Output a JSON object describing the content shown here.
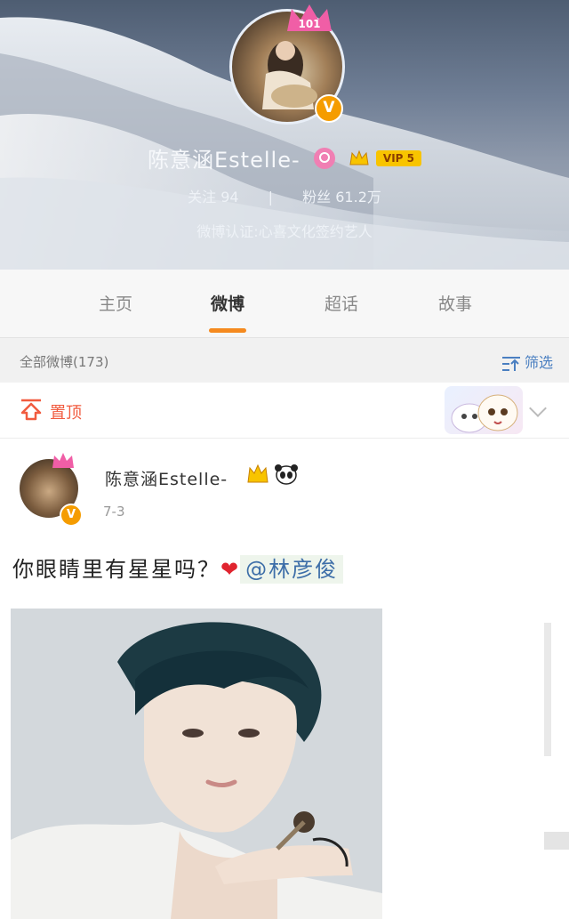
{
  "profile": {
    "name": "陈意涵Estelle-",
    "vip": "VIP 5",
    "crown_text": "101",
    "verified_mark": "V",
    "follow": "关注 94",
    "separator": "|",
    "fans": "粉丝 61.2万",
    "verification": "微博认证:心喜文化签约艺人"
  },
  "tabs": [
    {
      "label": "主页",
      "active": false
    },
    {
      "label": "微博",
      "active": true
    },
    {
      "label": "超话",
      "active": false
    },
    {
      "label": "故事",
      "active": false
    }
  ],
  "filter": {
    "all_label": "全部微博(173)",
    "filter_label": "筛选"
  },
  "pinned": {
    "label": "置顶"
  },
  "post": {
    "author": "陈意涵Estelle-",
    "verified_mark": "V",
    "date": "7-3",
    "text": "你眼睛里有星星吗？",
    "heart": "❤",
    "mention": "@林彦俊"
  },
  "colors": {
    "accent": "#f58a1f",
    "link": "#4a7fc1",
    "pinned": "#f15b3f",
    "vip": "#f8c400"
  },
  "icons": [
    "search-icon",
    "crown-icon",
    "filter-icon",
    "pin-icon",
    "chevron-down-icon",
    "panda-icon"
  ]
}
